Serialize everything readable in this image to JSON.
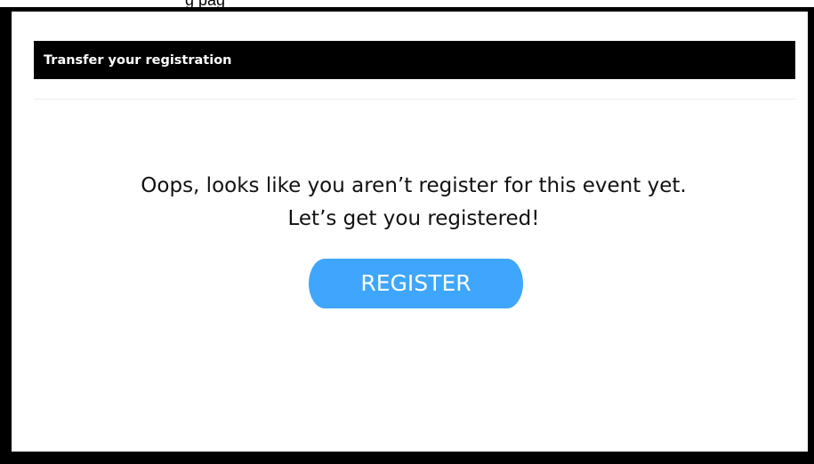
{
  "top_caption": "g pag",
  "dialog": {
    "header_title": "Transfer your registration",
    "message_line1": "Oops, looks like you aren’t register for this event yet.",
    "message_line2": "Let’s get you registered!",
    "register_button_label": "REGISTER"
  },
  "colors": {
    "header_background": "#000000",
    "header_text": "#ffffff",
    "button_background": "#3fa6fd",
    "button_text": "#ffffff",
    "frame_border": "#000000"
  }
}
